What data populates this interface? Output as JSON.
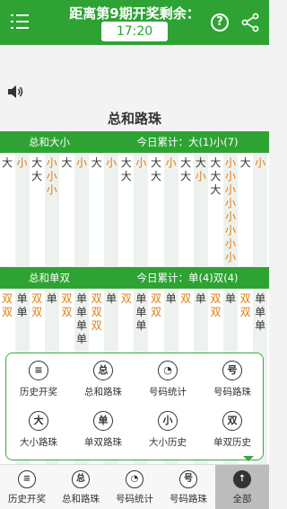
{
  "header": {
    "title": "距离第9期开奖剩余：",
    "countdown": "17:20",
    "help_symbol": "?"
  },
  "section_title": "总和路珠",
  "big_small": {
    "left_label": "总和大小",
    "right_label": "今日累计：大(1)小(7)",
    "columns": [
      [
        "大"
      ],
      [
        "小"
      ],
      [
        "大",
        "大"
      ],
      [
        "小",
        "小",
        "小"
      ],
      [
        "大"
      ],
      [
        "小"
      ],
      [
        "大"
      ],
      [
        "小"
      ],
      [
        "大",
        "大"
      ],
      [
        "小"
      ],
      [
        "大",
        "大"
      ],
      [
        "小"
      ],
      [
        "大",
        "大"
      ],
      [
        "大",
        "小"
      ],
      [
        "大",
        "大",
        "大"
      ],
      [
        "小",
        "小",
        "小",
        "小",
        "小",
        "小",
        "小",
        "小"
      ],
      [
        "大"
      ],
      [
        "小"
      ]
    ]
  },
  "odd_even": {
    "left_label": "总和单双",
    "right_label": "今日累计：单(4)双(4)",
    "columns": [
      [
        "双",
        "双"
      ],
      [
        "单",
        "单"
      ],
      [
        "双",
        "双"
      ],
      [
        "单"
      ],
      [
        "双",
        "双"
      ],
      [
        "单",
        "单",
        "单",
        "单"
      ],
      [
        "双",
        "双",
        "双"
      ],
      [
        "单"
      ],
      [
        "双"
      ],
      [
        "单",
        "单",
        "单"
      ],
      [
        "双",
        "双"
      ],
      [
        "单"
      ],
      [
        "双"
      ],
      [
        "单"
      ],
      [
        "双",
        "双"
      ],
      [
        "单"
      ],
      [
        "双",
        "双"
      ],
      [
        "单",
        "单",
        "单"
      ]
    ]
  },
  "popup_menu": [
    {
      "icon": "≡",
      "label": "历史开奖"
    },
    {
      "icon": "总",
      "label": "总和路珠"
    },
    {
      "icon": "◔",
      "label": "号码统计"
    },
    {
      "icon": "号",
      "label": "号码路珠"
    },
    {
      "icon": "大",
      "label": "大小路珠"
    },
    {
      "icon": "单",
      "label": "单双路珠"
    },
    {
      "icon": "小",
      "label": "大小历史"
    },
    {
      "icon": "双",
      "label": "单双历史"
    }
  ],
  "bottom_nav": [
    {
      "icon": "≡",
      "label": "历史开奖"
    },
    {
      "icon": "总",
      "label": "总和路珠"
    },
    {
      "icon": "◔",
      "label": "号码统计"
    },
    {
      "icon": "号",
      "label": "号码路珠"
    },
    {
      "icon": "↑",
      "label": "全部"
    }
  ],
  "colors": {
    "brand_green": "#2ea334",
    "accent_orange": "#e07b12"
  }
}
